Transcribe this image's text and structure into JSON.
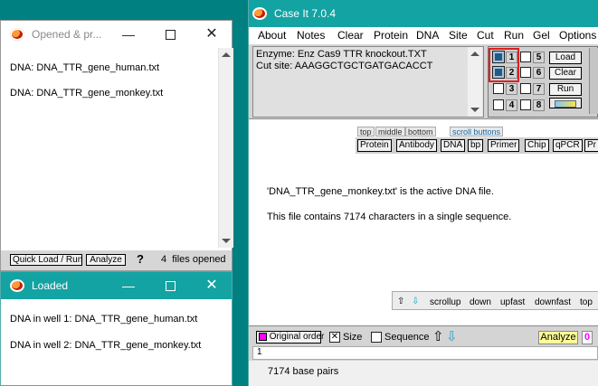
{
  "opened_window": {
    "title": "Opened & pr...",
    "files": [
      "DNA: DNA_TTR_gene_human.txt",
      "DNA: DNA_TTR_gene_monkey.txt"
    ],
    "quick_load_label": "Quick Load / Run",
    "analyze_label": "Analyze",
    "help_label": "?",
    "status": "4  files opened"
  },
  "loaded_window": {
    "title": "Loaded",
    "wells": [
      "DNA in well 1:  DNA_TTR_gene_human.txt",
      "DNA in well 2:  DNA_TTR_gene_monkey.txt"
    ]
  },
  "main_window": {
    "title": "Case It 7.0.4",
    "menu": [
      "About",
      "Notes",
      "Clear",
      "Protein",
      "DNA",
      "Site",
      "Cut",
      "Run",
      "Gel",
      "Options"
    ],
    "enzyme_line": "Enzyme: Enz Cas9 TTR knockout.TXT",
    "cut_site_line": "Cut site: AAAGGCTGCTGATGACACCT",
    "wells": [
      "1",
      "2",
      "3",
      "4",
      "5",
      "6",
      "7",
      "8"
    ],
    "gel_buttons": [
      "Load",
      "Clear",
      "Run"
    ],
    "tabs": [
      "top",
      "middle",
      "bottom"
    ],
    "scroll_buttons_label": "scroll buttons",
    "tool_buttons": [
      "Protein",
      "Antibody",
      "DNA",
      "bp",
      "Primer",
      "Chip",
      "qPCR",
      "Pr"
    ],
    "active_message": "'DNA_TTR_gene_monkey.txt' is the active DNA file.",
    "info_message": "This file contains 7174 characters in a single sequence.",
    "nav": [
      "scrollup",
      "down",
      "upfast",
      "downfast",
      "top"
    ],
    "original_order_label": "Original order",
    "size_label": "Size",
    "sequence_label": "Sequence",
    "analyze_label": "Analyze",
    "zero_label": "0",
    "position_value": "1",
    "base_pairs": "7174 base pairs",
    "highlight_color": "#e02020",
    "accent_magenta": "#ff00ff"
  }
}
